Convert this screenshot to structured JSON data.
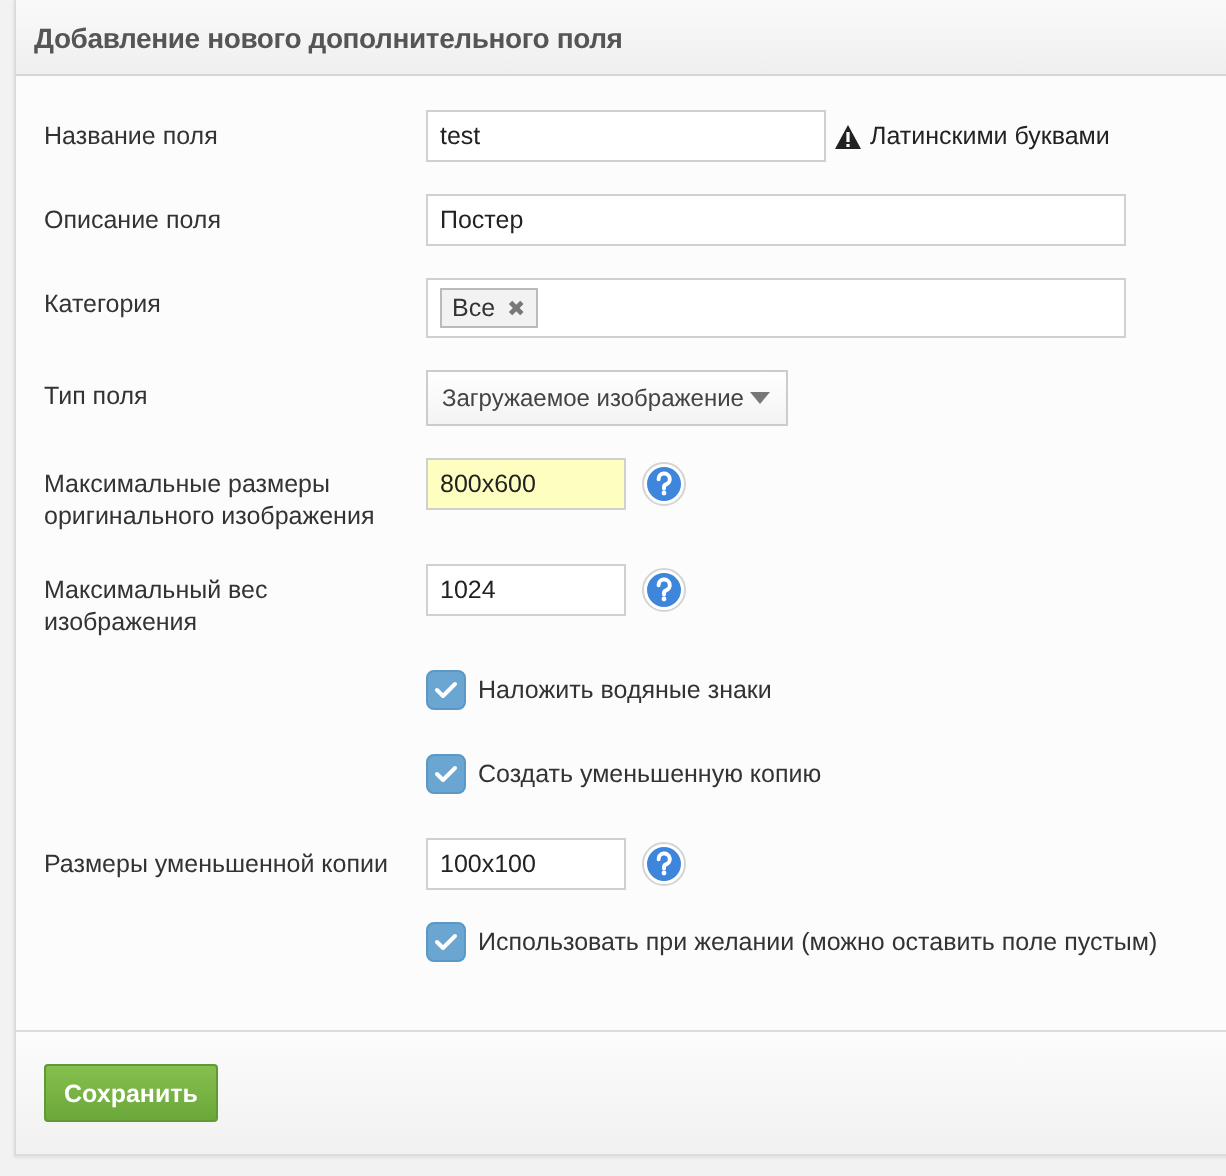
{
  "panel": {
    "title": "Добавление нового дополнительного поля"
  },
  "rows": [
    {
      "kind": "text",
      "label": "Название поля",
      "value": "test",
      "hint": "Латинскими буквами"
    },
    {
      "kind": "text",
      "label": "Описание поля",
      "value": "Постер"
    },
    {
      "kind": "tags",
      "label": "Категория",
      "tags": [
        {
          "text": "Все",
          "remove": "✖"
        }
      ]
    },
    {
      "kind": "select",
      "label": "Тип поля",
      "value": "Загружаемое изображение"
    },
    {
      "kind": "text",
      "label": "Максимальные размеры оригинального изображения",
      "value": "800x600",
      "highlighted": true,
      "help": true
    },
    {
      "kind": "text",
      "label": "Максимальный вес изображения",
      "value": "1024",
      "highlighted": false,
      "help": true
    },
    {
      "kind": "checkbox",
      "text": "Наложить водяные знаки",
      "checked": true
    },
    {
      "kind": "checkbox",
      "text": "Создать уменьшенную копию",
      "checked": true
    },
    {
      "kind": "text",
      "label": "Размеры уменьшенной копии",
      "value": "100x100",
      "highlighted": false,
      "help": true
    },
    {
      "kind": "checkbox",
      "text": "Использовать при желании (можно оставить поле пустым)",
      "checked": true
    }
  ],
  "buttons": [
    {
      "label": "Сохранить"
    }
  ]
}
